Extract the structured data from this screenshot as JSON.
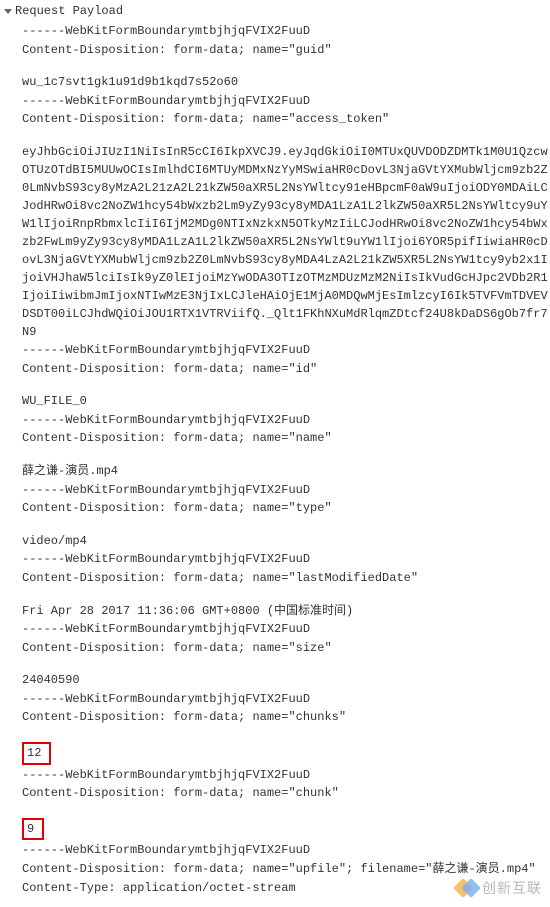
{
  "header": {
    "title": "Request Payload"
  },
  "fields": [
    {
      "boundary": "------WebKitFormBoundarymtbjhjqFVIX2FuuD",
      "disposition": "Content-Disposition: form-data; name=\"guid\"",
      "value": "wu_1c7svt1gk1u91d9b1kqd7s52o60"
    },
    {
      "boundary": "------WebKitFormBoundarymtbjhjqFVIX2FuuD",
      "disposition": "Content-Disposition: form-data; name=\"access_token\"",
      "value_is_token": true,
      "value": "eyJhbGciOiJIUzI1NiIsInR5cCI6IkpXVCJ9.eyJqdGkiOiI0MTUxQUVDODZDMTk1M0U1QzcwOTUzOTdBI5MUUwOCIsImlhdCI6MTUyMDMxNzYyMSwiaHR0cDovL3NjaGVtYXMubWljcm9zb2Z0LmNvbS93cy8yMzA2L21zA2L21kZW50aXR5L2NsYWltcy91eHBpcmF0aW9uIjoiODY0MDAiLCJodHRwOi8vc2NoZW1hcy54bWxzb2Lm9yZy93cy8yMDA1LzA1L2lkZW50aXR5L2NsYWltcy9uYW1lIjoiRnpRbmxlcIiI6IjM2MDg0NTIxNzkxN5OTkyMzIiLCJodHRwOi8vc2NoZW1hcy54bWxzb2FwLm9yZy93cy8yMDA1LzA1L2lkZW50aXR5L2NsYWlt9uYW1lIjoi6YOR5pifIiwiaHR0cDovL3NjaGVtYXMubWljcm9zb2Z0LmNvbS93cy8yMDA4LzA2L21kZW5XR5L2NsYW1tcy9yb2x1IjoiVHJhaW5lciIsIk9yZ0lEIjoiMzYwODA3OTIzOTMzMDUzMzM2NiIsIkVudGcHJpc2VDb2R1IjoiIiwibmJmIjoxNTIwMzE3NjIxLCJleHAiOjE1MjA0MDQwMjEsImlzcyI6Ik5TVFVmTDVEVDSDT00iLCJhdWQiOiJOU1RTX1VTRViifQ._Qlt1FKhNXuMdRlqmZDtcf24U8kDaDS6gOb7fr7N9"
    },
    {
      "boundary": "------WebKitFormBoundarymtbjhjqFVIX2FuuD",
      "disposition": "Content-Disposition: form-data; name=\"id\"",
      "value": "WU_FILE_0"
    },
    {
      "boundary": "------WebKitFormBoundarymtbjhjqFVIX2FuuD",
      "disposition": "Content-Disposition: form-data; name=\"name\"",
      "value": "薛之谦-演员.mp4"
    },
    {
      "boundary": "------WebKitFormBoundarymtbjhjqFVIX2FuuD",
      "disposition": "Content-Disposition: form-data; name=\"type\"",
      "value": "video/mp4"
    },
    {
      "boundary": "------WebKitFormBoundarymtbjhjqFVIX2FuuD",
      "disposition": "Content-Disposition: form-data; name=\"lastModifiedDate\"",
      "value": "Fri Apr 28 2017 11:36:06 GMT+0800 (中国标准时间)"
    },
    {
      "boundary": "------WebKitFormBoundarymtbjhjqFVIX2FuuD",
      "disposition": "Content-Disposition: form-data; name=\"size\"",
      "value": "24040590"
    },
    {
      "boundary": "------WebKitFormBoundarymtbjhjqFVIX2FuuD",
      "disposition": "Content-Disposition: form-data; name=\"chunks\"",
      "value": "12",
      "highlight": true
    },
    {
      "boundary": "------WebKitFormBoundarymtbjhjqFVIX2FuuD",
      "disposition": "Content-Disposition: form-data; name=\"chunk\"",
      "value": "9",
      "highlight": true
    },
    {
      "boundary": "------WebKitFormBoundarymtbjhjqFVIX2FuuD",
      "disposition": "Content-Disposition: form-data; name=\"upfile\"; filename=\"薛之谦-演员.mp4\"",
      "content_type": "Content-Type: application/octet-stream"
    }
  ],
  "watermark": {
    "text": "创新互联"
  }
}
